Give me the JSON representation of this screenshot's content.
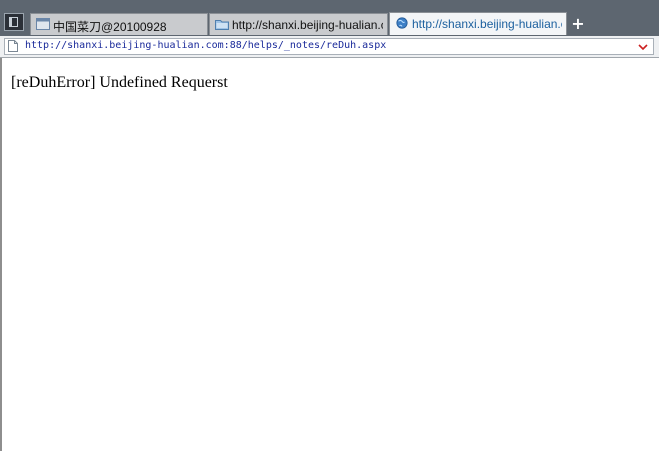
{
  "tabs": [
    {
      "label": "中国菜刀@20100928",
      "icon": "window-icon",
      "active": false
    },
    {
      "label": "http://shanxi.beijing-hualian.c...",
      "icon": "folder-icon",
      "active": false
    },
    {
      "label": "http://shanxi.beijing-hualian.c...",
      "icon": "globe-icon",
      "active": true
    }
  ],
  "new_tab_label": "+",
  "address": {
    "url": "http://shanxi.beijing-hualian.com:88/helps/_notes/reDuh.aspx"
  },
  "content": {
    "message": "[reDuhError] Undefined Requerst"
  },
  "colors": {
    "tabbar_bg": "#5d6670",
    "active_tab_text": "#1b5f9e",
    "url_text": "#1a2a9a",
    "dropdown_arrow": "#cc2020"
  }
}
